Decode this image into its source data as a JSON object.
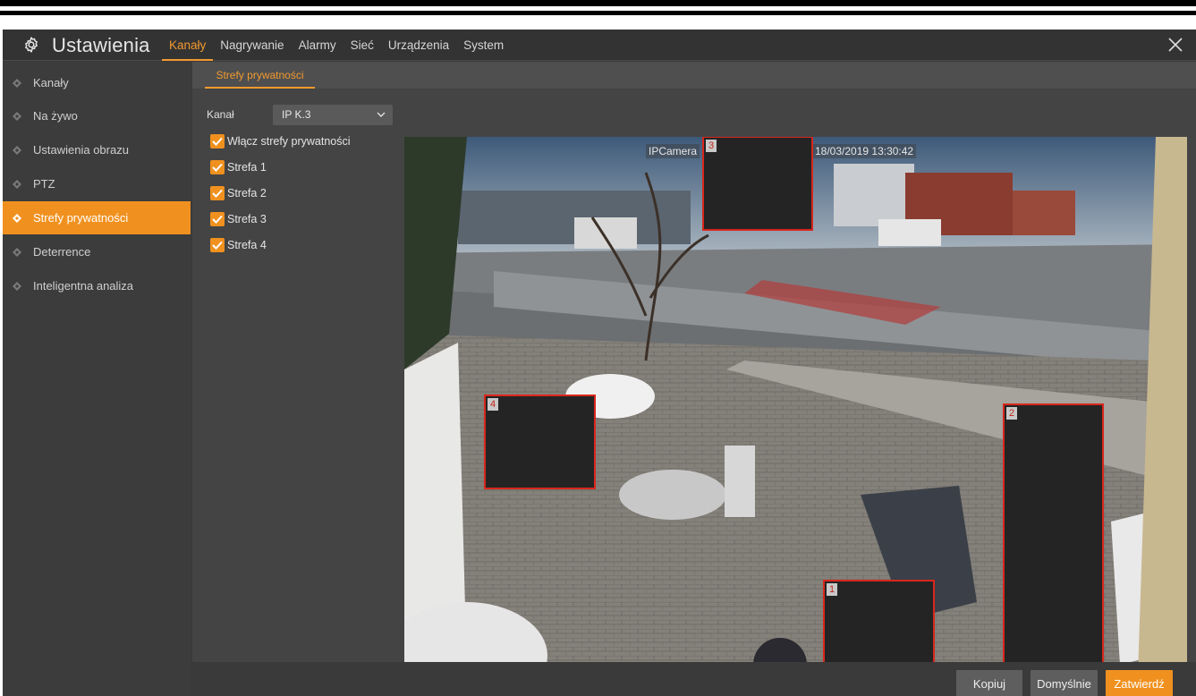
{
  "header": {
    "title": "Ustawienia",
    "nav": [
      "Kanały",
      "Nagrywanie",
      "Alarmy",
      "Sieć",
      "Urządzenia",
      "System"
    ],
    "active_nav": "Kanały",
    "gear_icon": "gear-icon",
    "close_icon": "close-icon"
  },
  "sidebar": {
    "items": [
      {
        "label": "Kanały"
      },
      {
        "label": "Na żywo"
      },
      {
        "label": "Ustawienia obrazu"
      },
      {
        "label": "PTZ"
      },
      {
        "label": "Strefy prywatności"
      },
      {
        "label": "Deterrence"
      },
      {
        "label": "Inteligentna analiza"
      }
    ],
    "active": "Strefy prywatności"
  },
  "subtab": {
    "label": "Strefy prywatności"
  },
  "form": {
    "channel_label": "Kanał",
    "channel_value": "IP K.3",
    "enable_label": "Włącz strefy prywatności",
    "zones": [
      {
        "label": "Strefa 1",
        "checked": true
      },
      {
        "label": "Strefa 2",
        "checked": true
      },
      {
        "label": "Strefa 3",
        "checked": true
      },
      {
        "label": "Strefa 4",
        "checked": true
      }
    ]
  },
  "video": {
    "camera_name": "IPCamera",
    "timestamp": "18/03/2019 13:30:42",
    "masks": [
      {
        "number": "1"
      },
      {
        "number": "2"
      },
      {
        "number": "3"
      },
      {
        "number": "4"
      }
    ]
  },
  "buttons": {
    "copy": "Kopiuj",
    "default": "Domyślnie",
    "confirm": "Zatwierdź"
  },
  "colors": {
    "accent": "#f0911f",
    "mask_border": "#d9261c",
    "background": "#3a3a3a"
  }
}
